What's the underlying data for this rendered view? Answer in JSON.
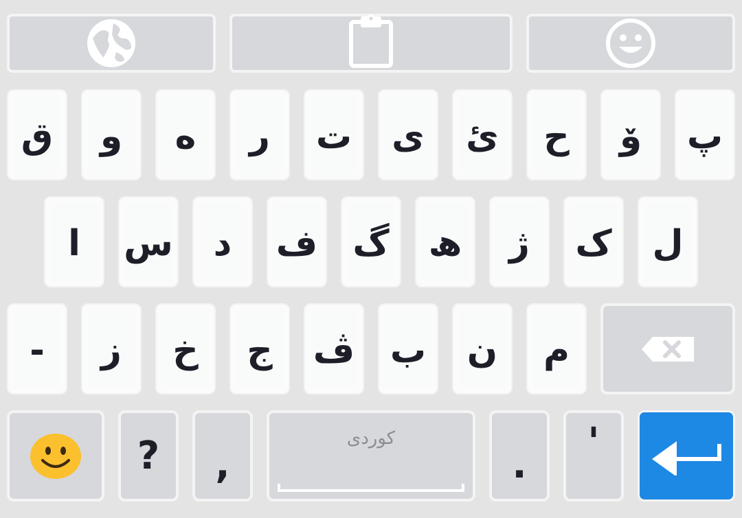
{
  "toolbar": {
    "globe_icon": "globe-icon",
    "clipboard_icon": "clipboard-icon",
    "emoji_icon": "smiley-icon"
  },
  "rows": {
    "row1": [
      "ق",
      "و",
      "ە",
      "ر",
      "ت",
      "ی",
      "ئ",
      "ح",
      "ۆ",
      "پ"
    ],
    "row2": [
      "ا",
      "س",
      "د",
      "ف",
      "گ",
      "ھ",
      "ژ",
      "ک",
      "ل"
    ],
    "row3": [
      "-",
      "ز",
      "خ",
      "ج",
      "ڤ",
      "ب",
      "ن",
      "م"
    ]
  },
  "bottom": {
    "question": "?",
    "comma": ",",
    "space_label": "کوردی",
    "period": ".",
    "apostrophe": "'"
  },
  "colors": {
    "background": "#e4e4e4",
    "key": "#f9fafa",
    "function_key": "#d6d8dc",
    "enter": "#1e88e5",
    "text": "#1e1e28"
  }
}
